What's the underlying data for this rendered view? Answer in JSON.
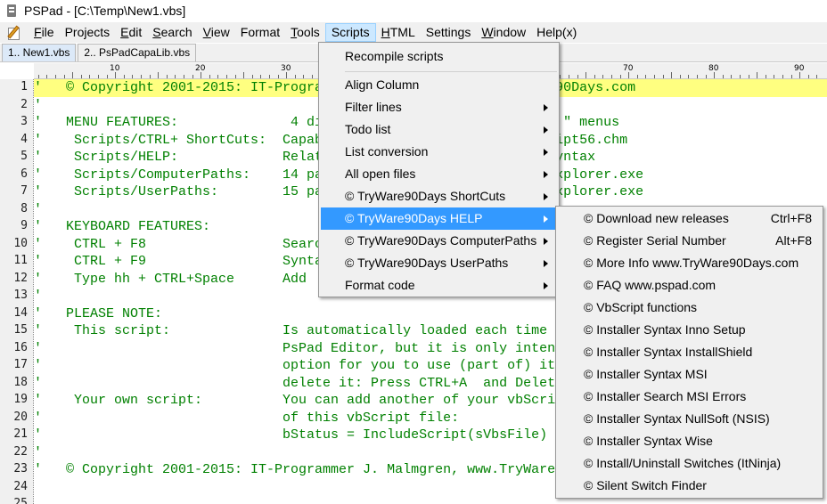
{
  "titlebar": {
    "title": "PSPad - [C:\\Temp\\New1.vbs]"
  },
  "menubar": {
    "items": [
      {
        "label": "File",
        "mnemonic": "F",
        "rest": "ile"
      },
      {
        "label": "Projects",
        "mnemonic": "",
        "rest": "Projects"
      },
      {
        "label": "Edit",
        "mnemonic": "E",
        "rest": "dit"
      },
      {
        "label": "Search",
        "mnemonic": "S",
        "rest": "earch"
      },
      {
        "label": "View",
        "mnemonic": "V",
        "rest": "iew"
      },
      {
        "label": "Format",
        "mnemonic": "",
        "rest": "Format"
      },
      {
        "label": "Tools",
        "mnemonic": "T",
        "rest": "ools"
      },
      {
        "label": "Scripts",
        "mnemonic": "",
        "rest": "Scripts"
      },
      {
        "label": "HTML",
        "mnemonic": "H",
        "rest": "TML"
      },
      {
        "label": "Settings",
        "mnemonic": "",
        "rest": "Settings"
      },
      {
        "label": "Window",
        "mnemonic": "W",
        "rest": "indow"
      },
      {
        "label": "Help(x)",
        "mnemonic": "",
        "rest": "Help(x)"
      }
    ]
  },
  "tabs": [
    {
      "label": "1.. New1.vbs",
      "active": true
    },
    {
      "label": "2.. PsPadCapaLib.vbs",
      "active": false
    }
  ],
  "ruler": {
    "labels": [
      "10",
      "20",
      "30",
      "40",
      "50",
      "60",
      "70",
      "80",
      "90"
    ]
  },
  "editor": {
    "line_numbers": [
      "1",
      "2",
      "3",
      "4",
      "5",
      "6",
      "7",
      "8",
      "9",
      "10",
      "11",
      "12",
      "13",
      "14",
      "15",
      "16",
      "17",
      "18",
      "19",
      "20",
      "21",
      "22",
      "23",
      "24",
      "25"
    ],
    "lines": [
      "'   © Copyright 2001-2015: IT-Programmer J. Malmgren, www.TryWare90Days.com",
      "'",
      "'   MENU FEATURES:              4 dialog menus \"TryWare90Days ... \" menus",
      "'    Scripts/CTRL+ ShortCuts:  Capabilities described in pspadscript56.chm",
      "'    Scripts/HELP:             Related HELP files e.g. InstallerSyntax",
      "'    Scripts/ComputerPaths:    14 paths to open in Windows File Explorer.exe",
      "'    Scripts/UserPaths:        15 paths to open in Windows File Explorer.exe",
      "'",
      "'   KEYBOARD FEATURES:",
      "'    CTRL + F8                 Search",
      "'    CTRL + F9                 Syntax",
      "'    Type hh + CTRL+Space      Add",
      "'",
      "'   PLEASE NOTE:",
      "'    This script:              Is automatically loaded each time",
      "'                              PsPad Editor, but it is only intended",
      "'                              option for you to use (part of) it",
      "'                              delete it: Press CTRL+A  and Delete",
      "'    Your own script:          You can add another of your vbScript",
      "'                              of this vbScript file:",
      "'                              bStatus = IncludeScript(sVbsFile)",
      "'",
      "'   © Copyright 2001-2015: IT-Programmer J. Malmgren, www.TryWare90Days.com",
      "",
      ""
    ]
  },
  "scripts_menu": {
    "items": [
      {
        "label": "Recompile scripts",
        "submenu": false
      },
      {
        "label": "Align Column",
        "submenu": false
      },
      {
        "label": "Filter lines",
        "submenu": true
      },
      {
        "label": "Todo list",
        "submenu": true
      },
      {
        "label": "List conversion",
        "submenu": true
      },
      {
        "label": "All open files",
        "submenu": true
      },
      {
        "label": "© TryWare90Days ShortCuts",
        "submenu": true
      },
      {
        "label": "© TryWare90Days HELP",
        "submenu": true,
        "selected": true
      },
      {
        "label": "© TryWare90Days ComputerPaths",
        "submenu": true
      },
      {
        "label": "© TryWare90Days UserPaths",
        "submenu": true
      },
      {
        "label": "Format code",
        "submenu": true
      }
    ]
  },
  "help_submenu": {
    "items": [
      {
        "label": "© Download new releases",
        "shortcut": "Ctrl+F8"
      },
      {
        "label": "© Register Serial Number",
        "shortcut": "Alt+F8"
      },
      {
        "label": "© More Info www.TryWare90Days.com",
        "shortcut": ""
      },
      {
        "label": "© FAQ www.pspad.com",
        "shortcut": ""
      },
      {
        "label": "© VbScript functions",
        "shortcut": ""
      },
      {
        "label": "© Installer Syntax Inno Setup",
        "shortcut": ""
      },
      {
        "label": "© Installer Syntax InstallShield",
        "shortcut": ""
      },
      {
        "label": "© Installer Syntax MSI",
        "shortcut": ""
      },
      {
        "label": "© Installer Search MSI Errors",
        "shortcut": ""
      },
      {
        "label": "© Installer Syntax NullSoft (NSIS)",
        "shortcut": ""
      },
      {
        "label": "© Installer Syntax Wise",
        "shortcut": ""
      },
      {
        "label": "© Install/Uninstall Switches (ItNinja)",
        "shortcut": ""
      },
      {
        "label": "© Silent Switch Finder",
        "shortcut": ""
      }
    ]
  },
  "colors": {
    "comment": "#008000",
    "highlight": "#ffff80",
    "menu_selected": "#3399ff",
    "menubar_active": "#cce8ff"
  }
}
